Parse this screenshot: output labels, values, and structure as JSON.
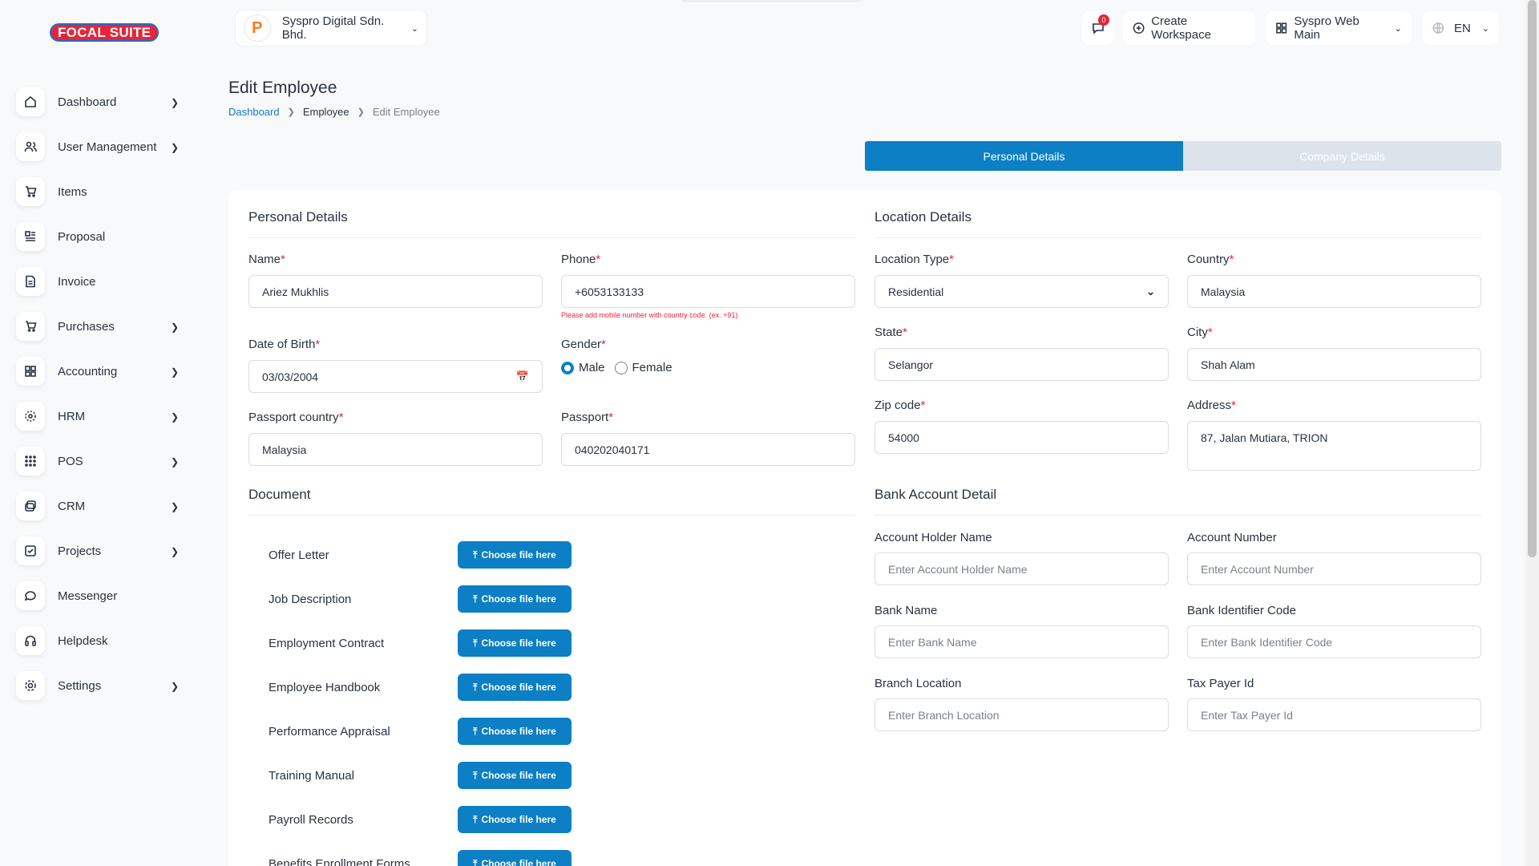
{
  "brand": {
    "logo_text": "FOCAL SUITE"
  },
  "header": {
    "company_name": "Syspro Digital Sdn. Bhd.",
    "messages_badge": "0",
    "create_workspace": "Create Workspace",
    "workspace": "Syspro Web Main",
    "language": "EN"
  },
  "sidebar": {
    "items": [
      {
        "label": "Dashboard",
        "icon": "home-icon",
        "has_children": true
      },
      {
        "label": "User Management",
        "icon": "users-icon",
        "has_children": true
      },
      {
        "label": "Items",
        "icon": "cart-icon",
        "has_children": false
      },
      {
        "label": "Proposal",
        "icon": "proposal-icon",
        "has_children": false
      },
      {
        "label": "Invoice",
        "icon": "file-icon",
        "has_children": false
      },
      {
        "label": "Purchases",
        "icon": "cart-icon",
        "has_children": true
      },
      {
        "label": "Accounting",
        "icon": "grid-icon",
        "has_children": true
      },
      {
        "label": "HRM",
        "icon": "hrm-icon",
        "has_children": true
      },
      {
        "label": "POS",
        "icon": "dots-grid-icon",
        "has_children": true
      },
      {
        "label": "CRM",
        "icon": "crm-icon",
        "has_children": true
      },
      {
        "label": "Projects",
        "icon": "check-square-icon",
        "has_children": true
      },
      {
        "label": "Messenger",
        "icon": "chat-icon",
        "has_children": false
      },
      {
        "label": "Helpdesk",
        "icon": "headset-icon",
        "has_children": false
      },
      {
        "label": "Settings",
        "icon": "gear-icon",
        "has_children": true
      }
    ]
  },
  "page": {
    "title": "Edit Employee",
    "breadcrumb": [
      "Dashboard",
      "Employee",
      "Edit Employee"
    ]
  },
  "tabs": {
    "personal": "Personal Details",
    "company": "Company Details"
  },
  "personal": {
    "title": "Personal Details",
    "name_label": "Name",
    "name_value": "Ariez Mukhlis",
    "phone_label": "Phone",
    "phone_value": "+6053133133",
    "phone_hint": "Please add mobile number with country code. (ex. +91)",
    "dob_label": "Date of Birth",
    "dob_value": "03/03/2004",
    "gender_label": "Gender",
    "gender_male": "Male",
    "gender_female": "Female",
    "passport_country_label": "Passport country",
    "passport_country_value": "Malaysia",
    "passport_label": "Passport",
    "passport_value": "040202040171"
  },
  "location": {
    "title": "Location Details",
    "type_label": "Location Type",
    "type_value": "Residential",
    "country_label": "Country",
    "country_value": "Malaysia",
    "state_label": "State",
    "state_value": "Selangor",
    "city_label": "City",
    "city_value": "Shah Alam",
    "zip_label": "Zip code",
    "zip_value": "54000",
    "address_label": "Address",
    "address_value": "87, Jalan Mutiara, TRION"
  },
  "bank": {
    "title": "Bank Account Detail",
    "holder_label": "Account Holder Name",
    "holder_placeholder": "Enter Account Holder Name",
    "number_label": "Account Number",
    "number_placeholder": "Enter Account Number",
    "bank_label": "Bank Name",
    "bank_placeholder": "Enter Bank Name",
    "bic_label": "Bank Identifier Code",
    "bic_placeholder": "Enter Bank Identifier Code",
    "branch_label": "Branch Location",
    "branch_placeholder": "Enter Branch Location",
    "tax_label": "Tax Payer Id",
    "tax_placeholder": "Enter Tax Payer Id"
  },
  "documents": {
    "title": "Document",
    "button_label": "Choose file here",
    "items": [
      "Offer Letter",
      "Job Description",
      "Employment Contract",
      "Employee Handbook",
      "Performance Appraisal",
      "Training Manual",
      "Payroll Records",
      "Benefits Enrollment Forms"
    ]
  }
}
